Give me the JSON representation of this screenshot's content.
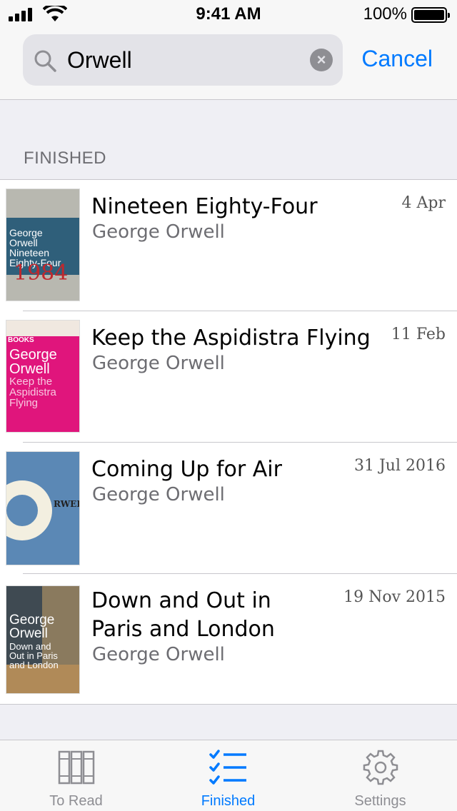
{
  "status_bar": {
    "time": "9:41 AM",
    "battery_percent": "100%"
  },
  "search": {
    "query": "Orwell",
    "cancel_label": "Cancel"
  },
  "section": {
    "title": "FINISHED"
  },
  "books": [
    {
      "title": "Nineteen Eighty-Four",
      "author": "George Orwell",
      "date": "4 Apr",
      "cover_text": "George\nOrwell\nNineteen\nEighty-Four",
      "cover_colors": [
        "#2f5f7a",
        "#b8b8b0"
      ]
    },
    {
      "title": "Keep the Aspidistra Flying",
      "author": "George Orwell",
      "date": "11 Feb",
      "cover_text": "George\nOrwell\nKeep the\nAspidistra\nFlying",
      "cover_colors": [
        "#e0157c",
        "#f0e8e0"
      ]
    },
    {
      "title": "Coming Up for Air",
      "author": "George Orwell",
      "date": "31 Jul 2016",
      "cover_text": "",
      "cover_colors": [
        "#5b88b5",
        "#f3efe0"
      ]
    },
    {
      "title": "Down and Out in Paris and London",
      "author": "George Orwell",
      "date": "19 Nov 2015",
      "cover_text": "George\nOrwell\nDown and\nOut in Paris\nand London",
      "cover_colors": [
        "#3f4a52",
        "#c9b48a"
      ]
    }
  ],
  "tabs": [
    {
      "label": "To Read",
      "icon": "books-icon",
      "active": false
    },
    {
      "label": "Finished",
      "icon": "checklist-icon",
      "active": true
    },
    {
      "label": "Settings",
      "icon": "gear-icon",
      "active": false
    }
  ],
  "colors": {
    "accent": "#007aff",
    "secondary_text": "#6d6d72",
    "background": "#efeff4"
  }
}
